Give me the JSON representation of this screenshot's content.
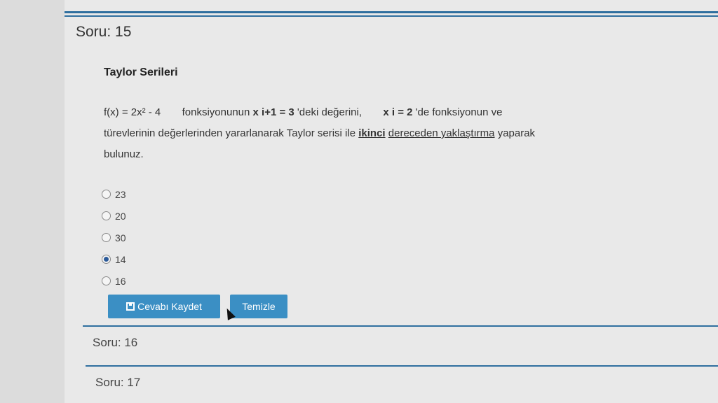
{
  "question": {
    "number_label": "Soru: 15",
    "title": "Taylor Serileri",
    "function_text": "f(x) = 2x² - 4",
    "line1_part1": "fonksiyonunun",
    "xi1_expr": "x i+1 = 3",
    "line1_part2": "'deki değerini,",
    "xi_expr": "x i = 2",
    "line1_part3": "'de  fonksiyonun ve",
    "line2_part1": "türevlerinin değerlerinden yararlanarak Taylor serisi ile",
    "line2_bold": "ikinci",
    "line2_underlined": "dereceden yaklaştırma",
    "line2_part2": "yaparak",
    "line3": "bulunuz."
  },
  "options": [
    {
      "label": "23",
      "checked": false
    },
    {
      "label": "20",
      "checked": false
    },
    {
      "label": "30",
      "checked": false
    },
    {
      "label": "14",
      "checked": true
    },
    {
      "label": "16",
      "checked": false
    }
  ],
  "buttons": {
    "save_label": "Cevabı Kaydet",
    "clear_label": "Temizle"
  },
  "next_questions": {
    "q16_label": "Soru: 16",
    "q17_label": "Soru: 17"
  },
  "colors": {
    "accent": "#2f6f9f",
    "button": "#3b8fc4"
  }
}
